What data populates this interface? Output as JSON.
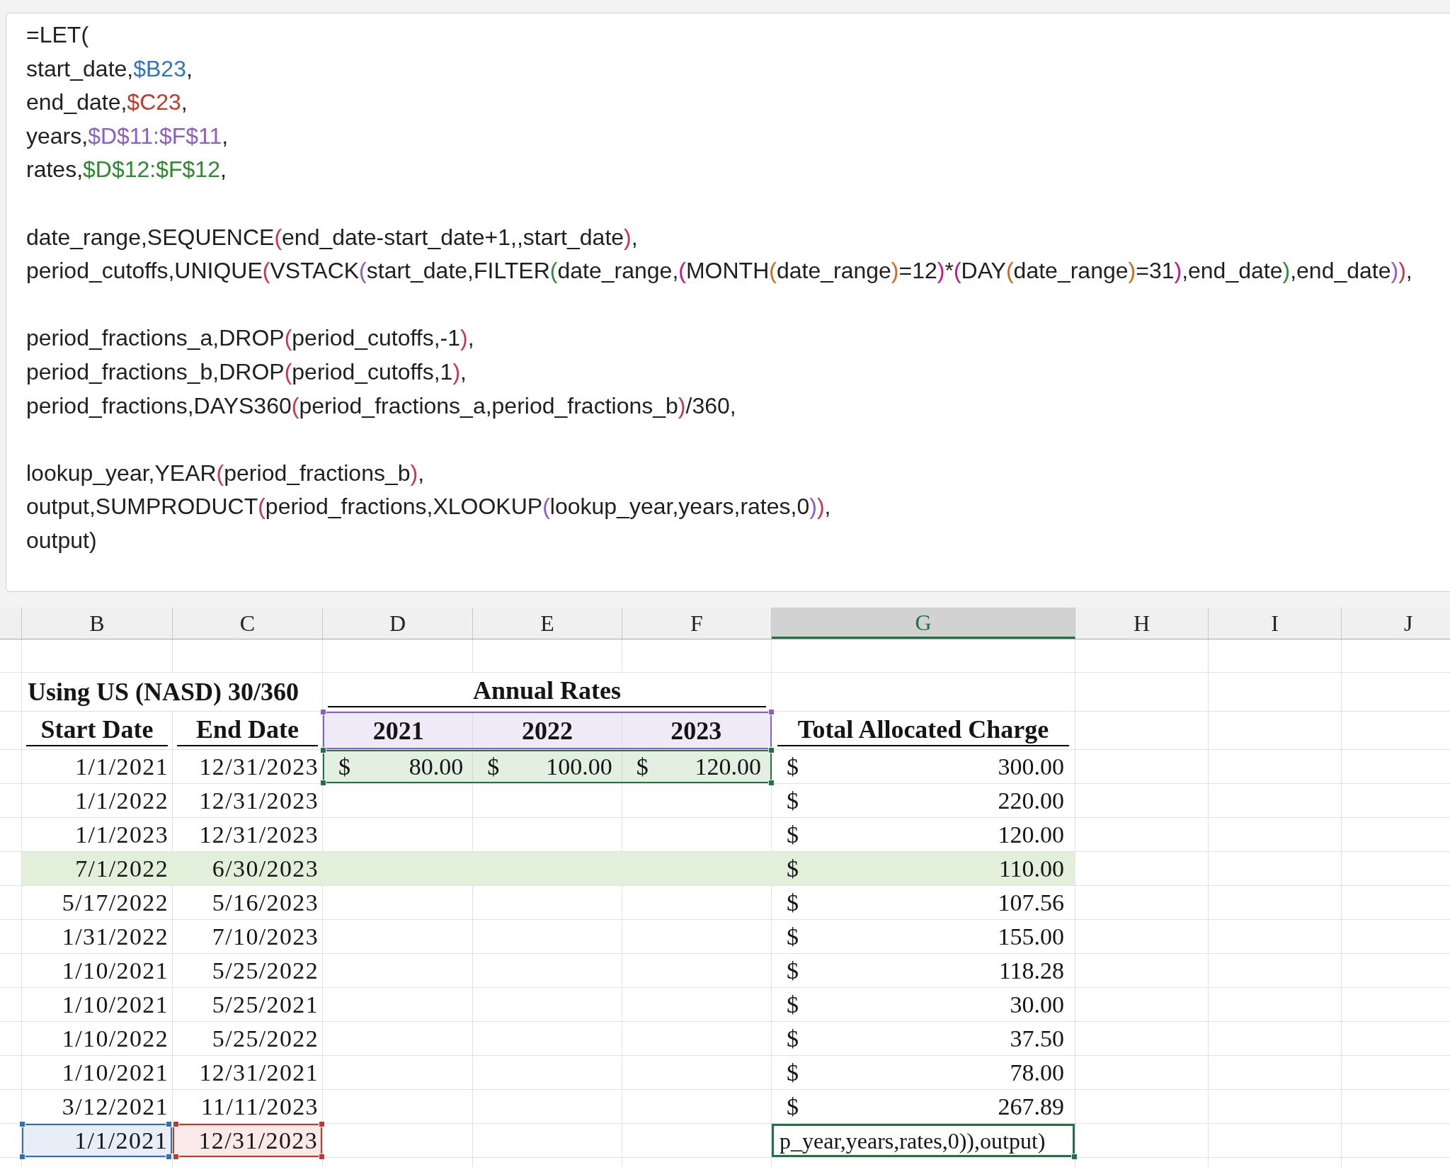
{
  "formula_bar": {
    "blocks": [
      [
        [
          {
            "text": "=LET("
          }
        ],
        [
          {
            "text": "start_date,"
          },
          {
            "text": "$B23",
            "color": "#2f75c0"
          },
          {
            "text": ","
          }
        ],
        [
          {
            "text": "end_date,"
          },
          {
            "text": "$C23",
            "color": "#c0392b"
          },
          {
            "text": ","
          }
        ],
        [
          {
            "text": "years,"
          },
          {
            "text": "$D$11:$F$11",
            "color": "#8a5fc8"
          },
          {
            "text": ","
          }
        ],
        [
          {
            "text": "rates,"
          },
          {
            "text": "$D$12:$F$12",
            "color": "#2b8a2e"
          },
          {
            "text": ","
          }
        ]
      ],
      [
        [
          {
            "text": "date_range,SEQUENCE"
          },
          {
            "text": "(",
            "color": "#c9364a"
          },
          {
            "text": "end_date-start_date+1,,start_date"
          },
          {
            "text": ")",
            "color": "#c9364a"
          },
          {
            "text": ","
          }
        ],
        [
          {
            "text": "period_cutoffs,UNIQUE"
          },
          {
            "text": "(",
            "color": "#c9364a"
          },
          {
            "text": "VSTACK"
          },
          {
            "text": "(",
            "color": "#8e5cc6"
          },
          {
            "text": "start_date,FILTER"
          },
          {
            "text": "(",
            "color": "#2e8b3c"
          },
          {
            "text": "date_range,"
          },
          {
            "text": "(",
            "color": "#c0158f"
          },
          {
            "text": "MONTH"
          },
          {
            "text": "(",
            "color": "#cc6a1f"
          },
          {
            "text": "date_range"
          },
          {
            "text": ")",
            "color": "#cc6a1f"
          },
          {
            "text": "=12"
          },
          {
            "text": ")",
            "color": "#c0158f"
          },
          {
            "text": "*"
          },
          {
            "text": "(",
            "color": "#c0158f"
          },
          {
            "text": "DAY"
          },
          {
            "text": "(",
            "color": "#cc6a1f"
          },
          {
            "text": "date_range"
          },
          {
            "text": ")",
            "color": "#cc6a1f"
          },
          {
            "text": "=31"
          },
          {
            "text": ")",
            "color": "#c0158f"
          },
          {
            "text": ",end_date"
          },
          {
            "text": ")",
            "color": "#2e8b3c"
          },
          {
            "text": ",end_date"
          },
          {
            "text": ")",
            "color": "#8e5cc6"
          },
          {
            "text": ")",
            "color": "#c9364a"
          },
          {
            "text": ","
          }
        ]
      ],
      [
        [
          {
            "text": "period_fractions_a,DROP"
          },
          {
            "text": "(",
            "color": "#c9364a"
          },
          {
            "text": "period_cutoffs,-1"
          },
          {
            "text": ")",
            "color": "#c9364a"
          },
          {
            "text": ","
          }
        ],
        [
          {
            "text": "period_fractions_b,DROP"
          },
          {
            "text": "(",
            "color": "#c9364a"
          },
          {
            "text": "period_cutoffs,1"
          },
          {
            "text": ")",
            "color": "#c9364a"
          },
          {
            "text": ","
          }
        ],
        [
          {
            "text": "period_fractions,DAYS360"
          },
          {
            "text": "(",
            "color": "#c9364a"
          },
          {
            "text": "period_fractions_a,period_fractions_b"
          },
          {
            "text": ")",
            "color": "#c9364a"
          },
          {
            "text": "/360,"
          }
        ]
      ],
      [
        [
          {
            "text": "lookup_year,YEAR"
          },
          {
            "text": "(",
            "color": "#c9364a"
          },
          {
            "text": "period_fractions_b"
          },
          {
            "text": ")",
            "color": "#c9364a"
          },
          {
            "text": ","
          }
        ],
        [
          {
            "text": "output,SUMPRODUCT"
          },
          {
            "text": "(",
            "color": "#c9364a"
          },
          {
            "text": "period_fractions,XLOOKUP"
          },
          {
            "text": "(",
            "color": "#8e5cc6"
          },
          {
            "text": "lookup_year,years,rates,0"
          },
          {
            "text": ")",
            "color": "#8e5cc6"
          },
          {
            "text": ")",
            "color": "#c9364a"
          },
          {
            "text": ","
          }
        ],
        [
          {
            "text": "output)"
          }
        ]
      ]
    ]
  },
  "sheet": {
    "columns": [
      {
        "label": "B",
        "selected": false
      },
      {
        "label": "C",
        "selected": false
      },
      {
        "label": "D",
        "selected": false
      },
      {
        "label": "E",
        "selected": false
      },
      {
        "label": "F",
        "selected": false
      },
      {
        "label": "G",
        "selected": true
      },
      {
        "label": "H",
        "selected": false
      },
      {
        "label": "I",
        "selected": false
      },
      {
        "label": "J",
        "selected": false
      }
    ],
    "title": "Using US (NASD) 30/360",
    "rates_heading": "Annual Rates",
    "start_heading": "Start Date",
    "end_heading": "End Date",
    "total_heading": "Total Allocated Charge",
    "years": {
      "referenced": true,
      "labels": [
        "2021",
        "2022",
        "2023"
      ]
    },
    "rates": {
      "referenced": true,
      "cells": [
        {
          "currency": "$",
          "amount": "80.00"
        },
        {
          "currency": "$",
          "amount": "100.00"
        },
        {
          "currency": "$",
          "amount": "120.00"
        }
      ]
    },
    "rows": [
      {
        "start": "1/1/2021",
        "end": "12/31/2023",
        "currency": "$",
        "total": "300.00",
        "highlighted": false,
        "referenced": false,
        "editing": false
      },
      {
        "start": "1/1/2022",
        "end": "12/31/2023",
        "currency": "$",
        "total": "220.00",
        "highlighted": false,
        "referenced": false,
        "editing": false
      },
      {
        "start": "1/1/2023",
        "end": "12/31/2023",
        "currency": "$",
        "total": "120.00",
        "highlighted": false,
        "referenced": false,
        "editing": false
      },
      {
        "start": "7/1/2022",
        "end": "6/30/2023",
        "currency": "$",
        "total": "110.00",
        "highlighted": true,
        "referenced": false,
        "editing": false
      },
      {
        "start": "5/17/2022",
        "end": "5/16/2023",
        "currency": "$",
        "total": "107.56",
        "highlighted": false,
        "referenced": false,
        "editing": false
      },
      {
        "start": "1/31/2022",
        "end": "7/10/2023",
        "currency": "$",
        "total": "155.00",
        "highlighted": false,
        "referenced": false,
        "editing": false
      },
      {
        "start": "1/10/2021",
        "end": "5/25/2022",
        "currency": "$",
        "total": "118.28",
        "highlighted": false,
        "referenced": false,
        "editing": false
      },
      {
        "start": "1/10/2021",
        "end": "5/25/2021",
        "currency": "$",
        "total": "30.00",
        "highlighted": false,
        "referenced": false,
        "editing": false
      },
      {
        "start": "1/10/2022",
        "end": "5/25/2022",
        "currency": "$",
        "total": "37.50",
        "highlighted": false,
        "referenced": false,
        "editing": false
      },
      {
        "start": "1/10/2021",
        "end": "12/31/2021",
        "currency": "$",
        "total": "78.00",
        "highlighted": false,
        "referenced": false,
        "editing": false
      },
      {
        "start": "3/12/2021",
        "end": "11/11/2023",
        "currency": "$",
        "total": "267.89",
        "highlighted": false,
        "referenced": false,
        "editing": false
      },
      {
        "start": "1/1/2021",
        "end": "12/31/2023",
        "total": "p_year,years,rates,0)),output)",
        "highlighted": false,
        "referenced": true,
        "editing": true
      }
    ]
  }
}
